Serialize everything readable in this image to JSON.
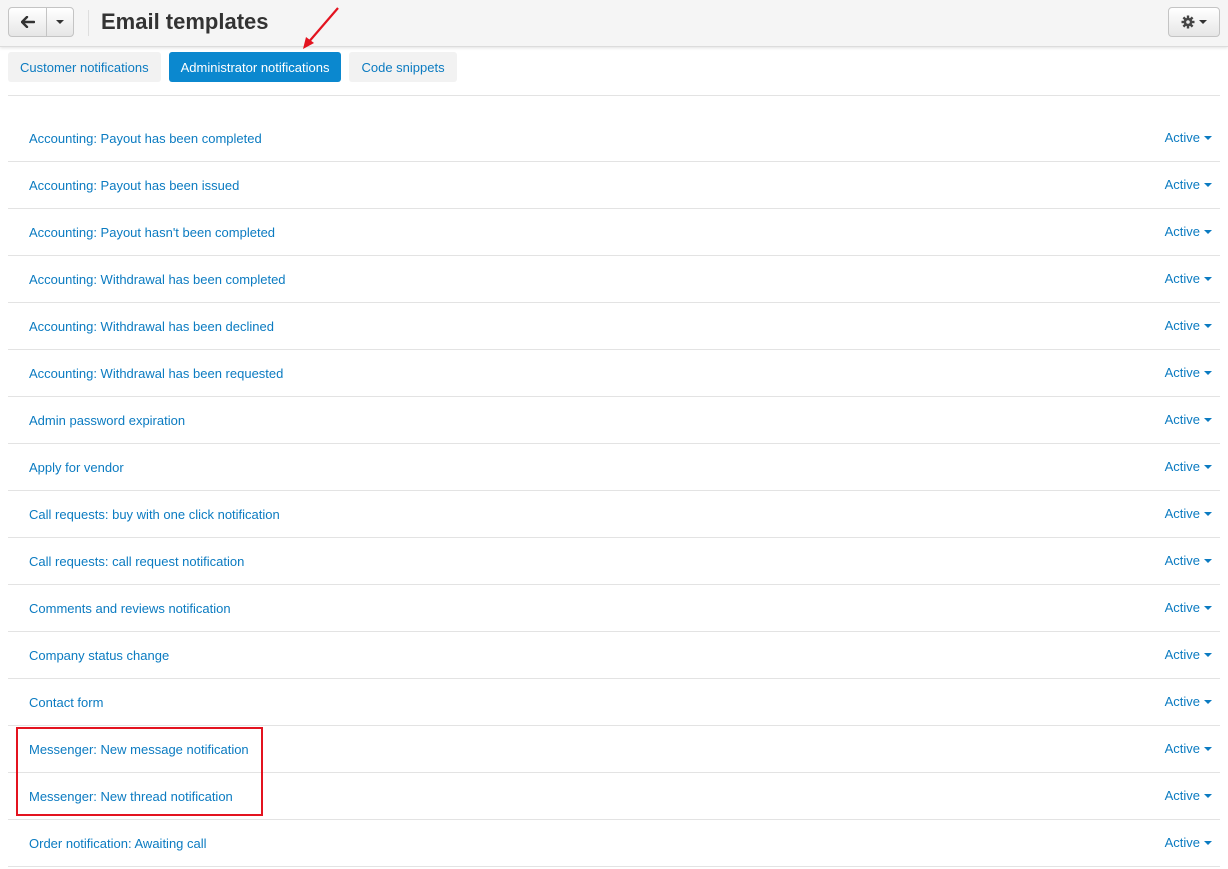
{
  "header": {
    "title": "Email templates"
  },
  "tabs": [
    {
      "label": "Customer notifications",
      "active": false
    },
    {
      "label": "Administrator notifications",
      "active": true
    },
    {
      "label": "Code snippets",
      "active": false
    }
  ],
  "templates": [
    {
      "name": "Accounting: Payout has been completed",
      "status": "Active"
    },
    {
      "name": "Accounting: Payout has been issued",
      "status": "Active"
    },
    {
      "name": "Accounting: Payout hasn't been completed",
      "status": "Active"
    },
    {
      "name": "Accounting: Withdrawal has been completed",
      "status": "Active"
    },
    {
      "name": "Accounting: Withdrawal has been declined",
      "status": "Active"
    },
    {
      "name": "Accounting: Withdrawal has been requested",
      "status": "Active"
    },
    {
      "name": "Admin password expiration",
      "status": "Active"
    },
    {
      "name": "Apply for vendor",
      "status": "Active"
    },
    {
      "name": "Call requests: buy with one click notification",
      "status": "Active"
    },
    {
      "name": "Call requests: call request notification",
      "status": "Active"
    },
    {
      "name": "Comments and reviews notification",
      "status": "Active"
    },
    {
      "name": "Company status change",
      "status": "Active"
    },
    {
      "name": "Contact form",
      "status": "Active"
    },
    {
      "name": "Messenger: New message notification",
      "status": "Active"
    },
    {
      "name": "Messenger: New thread notification",
      "status": "Active"
    },
    {
      "name": "Order notification: Awaiting call",
      "status": "Active"
    }
  ],
  "colors": {
    "link": "#0b7bc1",
    "active_tab": "#0b88cf",
    "annotation": "#e3131f"
  },
  "icons": {
    "back": "arrow-left-icon",
    "menu": "chevron-down-icon",
    "settings": "gear-icon"
  }
}
